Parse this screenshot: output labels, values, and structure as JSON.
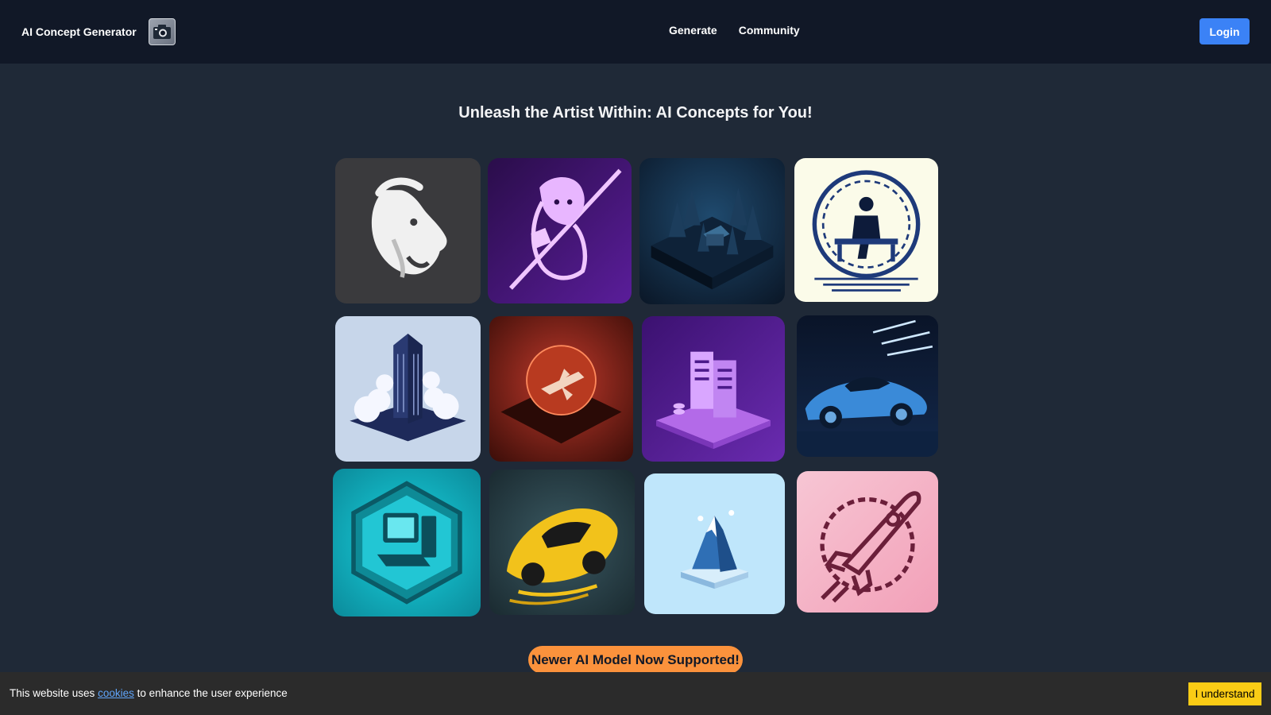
{
  "app": {
    "brand": "AI Concept Generator",
    "logo_icon": "camera-icon"
  },
  "nav": {
    "links": [
      "Generate",
      "Community"
    ],
    "login_label": "Login"
  },
  "hero": {
    "title": "Unleash the Artist Within: AI Concepts for You!"
  },
  "gallery": {
    "tiles": [
      {
        "subject": "white goat head logo",
        "icon": "goat-icon",
        "colors": [
          "#3a3a3d",
          "#f2f2f2"
        ]
      },
      {
        "subject": "anime swordsman in purple",
        "icon": "swordsman-icon",
        "colors": [
          "#3b1466",
          "#f0c6ff"
        ]
      },
      {
        "subject": "isometric forest cabin at night",
        "icon": "forest-cabin-icon",
        "colors": [
          "#0b1a2a",
          "#2f6f9f"
        ]
      },
      {
        "subject": "person sitting on bench circuit emblem",
        "icon": "bench-emblem-icon",
        "colors": [
          "#fbfbe9",
          "#1e3a7a"
        ]
      },
      {
        "subject": "isometric skyscraper in clouds",
        "icon": "skyscraper-icon",
        "colors": [
          "#c7d6ea",
          "#1e2a5a"
        ]
      },
      {
        "subject": "spaceship over red planet",
        "icon": "spaceship-planet-icon",
        "colors": [
          "#7a1d10",
          "#ff6a3d"
        ]
      },
      {
        "subject": "isometric purple server racks",
        "icon": "server-icon",
        "colors": [
          "#4b1a8a",
          "#c77dff"
        ]
      },
      {
        "subject": "blue sports car in garage",
        "icon": "sports-car-icon",
        "colors": [
          "#0a1428",
          "#4aa3ff"
        ]
      },
      {
        "subject": "teal hexagon computer",
        "icon": "computer-icon",
        "colors": [
          "#0fb3c4",
          "#063a47"
        ]
      },
      {
        "subject": "yellow racing car",
        "icon": "race-car-icon",
        "colors": [
          "#2d3f45",
          "#f2c21b"
        ]
      },
      {
        "subject": "ice crystal mountain",
        "icon": "ice-mountain-icon",
        "colors": [
          "#bfe6fb",
          "#2f6fb5"
        ]
      },
      {
        "subject": "rocket launch emblem",
        "icon": "rocket-icon",
        "colors": [
          "#f7b6c8",
          "#6b1f3a"
        ]
      }
    ]
  },
  "announcement": {
    "text": "Newer AI Model Now Supported!"
  },
  "cookie": {
    "text_before": "This website uses",
    "link_text": "cookies",
    "text_after": "to enhance the user experience",
    "accept_label": "I understand"
  },
  "colors": {
    "page_bg": "#1f2937",
    "nav_bg": "#111827",
    "login_btn": "#3b82f6",
    "banner": "#fb923c",
    "cookie_btn": "#facc15"
  }
}
